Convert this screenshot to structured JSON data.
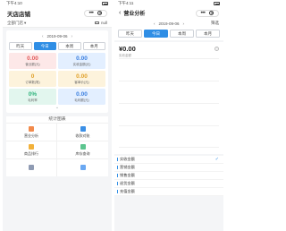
{
  "left": {
    "status": {
      "time": "下午4:10"
    },
    "title": "天店店铺",
    "store": {
      "selector": "全部门店",
      "arrow": "▾",
      "right_text": "null"
    },
    "date": {
      "prev": "‹",
      "value": "2019-09-06",
      "next": "›"
    },
    "tabs": [
      {
        "label": "昨天",
        "active": false
      },
      {
        "label": "今日",
        "active": true
      },
      {
        "label": "本周",
        "active": false
      },
      {
        "label": "本月",
        "active": false
      }
    ],
    "stats": [
      {
        "value": "0.00",
        "label": "营业额(元)",
        "color": "red"
      },
      {
        "value": "0.00",
        "label": "实收金额(元)",
        "color": "blue"
      },
      {
        "value": "0",
        "label": "订单数(笔)",
        "color": "yellow"
      },
      {
        "value": "0.00",
        "label": "客单价(元)",
        "color": "yellow"
      },
      {
        "value": "0%",
        "label": "毛利率",
        "color": "green"
      },
      {
        "value": "0.00",
        "label": "毛利额(元)",
        "color": "blue"
      }
    ],
    "expand": "⌄",
    "chart_title": "统计图表",
    "functions": [
      {
        "label": "营业分析",
        "color": "#f28a4b"
      },
      {
        "label": "收款对账",
        "color": "#3b8fe6"
      },
      {
        "label": "商品排行",
        "color": "#f2b13b"
      },
      {
        "label": "库存查询",
        "color": "#5cc58f"
      },
      {
        "label": "",
        "color": "#8f9bb3"
      },
      {
        "label": "",
        "color": "#6aa8f2"
      }
    ]
  },
  "right": {
    "status": {
      "time": "下午4:11"
    },
    "back": "‹",
    "title": "营业分析",
    "date": {
      "prev": "‹",
      "value": "2019-09-06",
      "next": "›",
      "filter": "筛选"
    },
    "tabs": [
      {
        "label": "昨天",
        "active": false
      },
      {
        "label": "今日",
        "active": true
      },
      {
        "label": "本周",
        "active": false
      },
      {
        "label": "本月",
        "active": false
      }
    ],
    "amount": "¥0.00",
    "amount_label": "实收金额",
    "help": "?",
    "list": [
      {
        "label": "实收金额",
        "checked": true
      },
      {
        "label": "营销金额",
        "checked": false
      },
      {
        "label": "销售金额",
        "checked": false
      },
      {
        "label": "退货金额",
        "checked": false
      },
      {
        "label": "充值金额",
        "checked": false
      }
    ],
    "check": "✓"
  }
}
